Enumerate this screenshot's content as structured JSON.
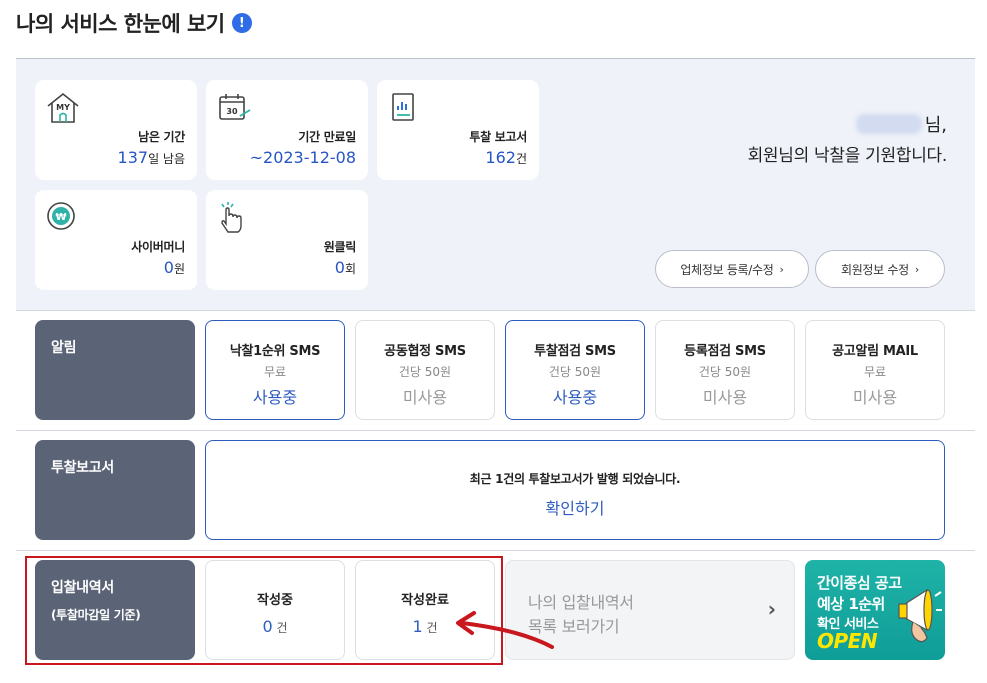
{
  "header": {
    "title": "나의 서비스 한눈에 보기",
    "info_icon": "info-icon"
  },
  "summary": {
    "cards": [
      {
        "icon": "my-home-icon",
        "label": "남은 기간",
        "value": "137",
        "unit": "일 남음"
      },
      {
        "icon": "calendar-30-icon",
        "label": "기간 만료일",
        "value": "~2023-12-08",
        "unit": ""
      },
      {
        "icon": "report-chart-icon",
        "label": "투찰 보고서",
        "value": "162",
        "unit": "건"
      },
      {
        "icon": "won-coin-icon",
        "label": "사이버머니",
        "value": "0",
        "unit": "원"
      },
      {
        "icon": "click-hand-icon",
        "label": "원클릭",
        "value": "0",
        "unit": "회"
      }
    ],
    "greeting_suffix": "님,",
    "greeting_msg": "회원님의 낙찰을 기원합니다.",
    "buttons": {
      "company_info": "업체정보 등록/수정",
      "member_info": "회원정보 수정"
    }
  },
  "alerts": {
    "label": "알림",
    "items": [
      {
        "title": "낙찰1순위 SMS",
        "price": "무료",
        "status": "사용중",
        "active": true
      },
      {
        "title": "공동협정 SMS",
        "price": "건당 50원",
        "status": "미사용",
        "active": false
      },
      {
        "title": "투찰점검 SMS",
        "price": "건당 50원",
        "status": "사용중",
        "active": true
      },
      {
        "title": "등록점검 SMS",
        "price": "건당 50원",
        "status": "미사용",
        "active": false
      },
      {
        "title": "공고알림 MAIL",
        "price": "무료",
        "status": "미사용",
        "active": false
      }
    ]
  },
  "report": {
    "label": "투찰보고서",
    "message": "최근 1건의 투찰보고서가 발행 되었습니다.",
    "link": "확인하기"
  },
  "bids": {
    "label": "입찰내역서",
    "sublabel": "(투찰마감일 기준)",
    "writing": {
      "title": "작성중",
      "count": "0",
      "unit": "건"
    },
    "completed": {
      "title": "작성완료",
      "count": "1",
      "unit": "건"
    },
    "goto_line1": "나의 입찰내역서",
    "goto_line2": "목록 보러가기"
  },
  "promo": {
    "line1": "간이종심 공고",
    "line2": "예상 1순위",
    "line3": "확인 서비스",
    "line4": "OPEN"
  },
  "colors": {
    "accent": "#2e5dbf",
    "label_bg": "#5b6477",
    "summary_bg": "#eff2f9",
    "highlight": "#c9171e",
    "promo": "#13a79f"
  }
}
